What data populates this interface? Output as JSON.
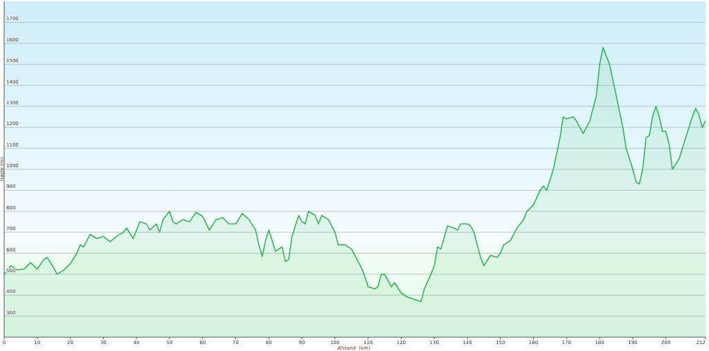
{
  "chart_data": {
    "type": "area",
    "xlabel": "Afstand  (km)",
    "ylabel": "Højde (m)",
    "x": [
      0,
      2,
      4,
      6,
      8,
      10,
      12,
      13,
      15,
      16,
      18,
      20,
      22,
      23,
      24,
      26,
      28,
      30,
      32,
      34,
      36,
      37,
      39,
      41,
      43,
      44,
      46,
      47,
      48,
      50,
      51,
      52,
      54,
      56,
      58,
      60,
      62,
      64,
      66,
      68,
      70,
      72,
      74,
      76,
      77,
      78,
      79,
      80,
      82,
      84,
      85,
      86,
      87,
      89,
      90,
      91,
      92,
      94,
      95,
      96,
      98,
      100,
      101,
      103,
      105,
      107,
      108,
      109,
      110,
      112,
      113,
      114,
      115,
      117,
      118,
      120,
      122,
      124,
      126,
      127,
      129,
      130,
      131,
      132,
      134,
      136,
      137,
      138,
      140,
      141,
      142,
      144,
      145,
      147,
      149,
      150,
      151,
      153,
      155,
      157,
      158,
      160,
      162,
      163,
      164,
      166,
      168,
      169,
      170,
      172,
      173,
      175,
      177,
      179,
      180,
      181,
      183,
      185,
      187,
      188,
      190,
      191,
      192,
      193,
      194,
      195,
      196,
      197,
      198,
      199,
      200,
      201,
      202,
      204,
      206,
      208,
      209,
      210,
      211,
      212
    ],
    "grid": true,
    "series": [
      {
        "color": "#2fb84f",
        "values": [
          500,
          540,
          520,
          525,
          555,
          525,
          570,
          580,
          530,
          500,
          520,
          550,
          600,
          640,
          630,
          690,
          670,
          680,
          655,
          680,
          700,
          720,
          670,
          750,
          740,
          710,
          740,
          700,
          760,
          800,
          750,
          740,
          760,
          750,
          795,
          775,
          710,
          760,
          770,
          740,
          740,
          790,
          760,
          710,
          640,
          585,
          660,
          710,
          610,
          630,
          560,
          570,
          680,
          780,
          750,
          740,
          800,
          780,
          740,
          780,
          760,
          700,
          640,
          640,
          620,
          560,
          530,
          490,
          440,
          430,
          440,
          500,
          500,
          440,
          460,
          410,
          390,
          380,
          370,
          430,
          500,
          540,
          630,
          620,
          730,
          720,
          710,
          740,
          740,
          730,
          700,
          580,
          540,
          590,
          580,
          600,
          640,
          660,
          720,
          760,
          800,
          830,
          900,
          920,
          900,
          1000,
          1150,
          1250,
          1240,
          1250,
          1230,
          1170,
          1230,
          1350,
          1500,
          1580,
          1500,
          1350,
          1200,
          1100,
          1000,
          940,
          930,
          1000,
          1150,
          1160,
          1250,
          1300,
          1250,
          1180,
          1180,
          1120,
          1000,
          1050,
          1150,
          1250,
          1290,
          1260,
          1200,
          1230
        ]
      }
    ],
    "xlim": [
      0,
      212
    ],
    "ylim": [
      200,
      1800
    ],
    "xticks": [
      0,
      10,
      20,
      30,
      40,
      50,
      60,
      70,
      80,
      90,
      100,
      110,
      120,
      130,
      140,
      150,
      160,
      170,
      180,
      190,
      200,
      212
    ],
    "yticks": [
      300,
      400,
      500,
      600,
      700,
      800,
      900,
      1000,
      1100,
      1200,
      1300,
      1400,
      1500,
      1600,
      1700
    ]
  }
}
